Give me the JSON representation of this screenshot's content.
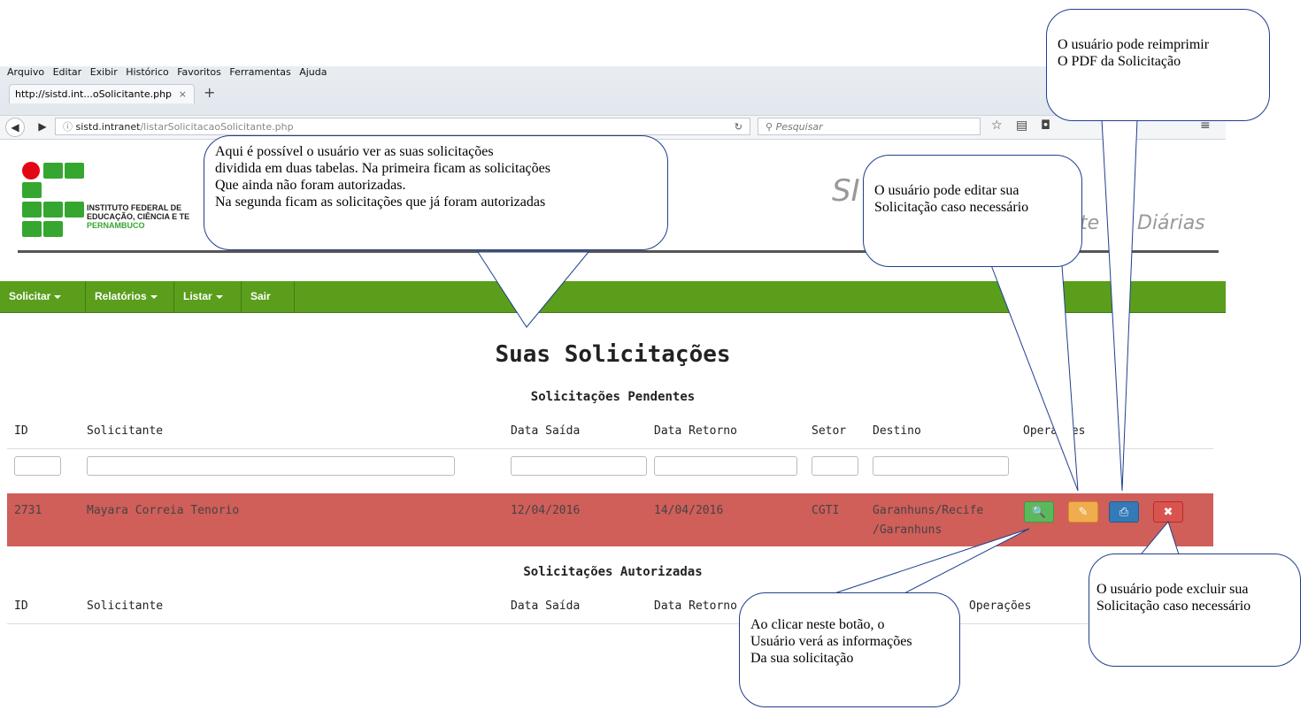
{
  "browser": {
    "menu": [
      "Arquivo",
      "Editar",
      "Exibir",
      "Histórico",
      "Favoritos",
      "Ferramentas",
      "Ajuda"
    ],
    "tab_title": "http://sistd.int...oSolicitante.php",
    "tab_close": "×",
    "new_tab": "+",
    "url_host": "sistd.intranet",
    "url_path": "/listarSolicitacaoSolicitante.php",
    "search_placeholder": "Pesquisar"
  },
  "header": {
    "inst_line1": "INSTITUTO FEDERAL DE",
    "inst_line2": "EDUCAÇÃO, CIÊNCIA E TE",
    "inst_line3": "PERNAMBUCO",
    "app_title_fragment": "SI",
    "app_subtitle_fragment": "te",
    "app_subtitle_fragment2": "Diárias"
  },
  "nav": {
    "solicitar": "Solicitar",
    "relatorios": "Relatórios",
    "listar": "Listar",
    "sair": "Sair"
  },
  "page": {
    "title": "Suas Solicitações",
    "pending_title": "Solicitações Pendentes",
    "authorized_title": "Solicitações Autorizadas"
  },
  "pending_table": {
    "headers": {
      "id": "ID",
      "solicitante": "Solicitante",
      "saida": "Data Saída",
      "retorno": "Data Retorno",
      "setor": "Setor",
      "destino": "Destino",
      "operacoes": "Operações"
    },
    "row": {
      "id": "2731",
      "solicitante": "Mayara Correia Tenorio",
      "saida": "12/04/2016",
      "retorno": "14/04/2016",
      "setor": "CGTI",
      "destino_l1": "Garanhuns/Recife",
      "destino_l2": "/Garanhuns"
    }
  },
  "authorized_table": {
    "headers": {
      "id": "ID",
      "solicitante": "Solicitante",
      "saida": "Data Saída",
      "retorno": "Data Retorno",
      "operacoes": "Operações"
    }
  },
  "colors": {
    "row_pending": "#d05e59",
    "nav": "#5a9e1c",
    "btn_view": "#5cb85c",
    "btn_edit": "#f0ad4e",
    "btn_pdf": "#337ab7",
    "btn_delete": "#d9534f"
  },
  "callouts": {
    "tables": [
      "Aqui é possível o usuário ver as suas solicitações",
      "dividida em duas tabelas. Na primeira ficam as solicitações",
      "Que ainda não foram autorizadas.",
      "Na segunda ficam as solicitações que já foram autorizadas"
    ],
    "pdf": [
      "O usuário pode reimprimir",
      "O PDF da Solicitação"
    ],
    "edit": [
      "O usuário pode editar sua",
      "Solicitação caso necessário"
    ],
    "delete": [
      "O usuário pode excluir sua",
      "Solicitação caso necessário"
    ],
    "view": [
      "Ao clicar neste botão, o",
      "Usuário verá as informações",
      "Da sua solicitação"
    ]
  }
}
